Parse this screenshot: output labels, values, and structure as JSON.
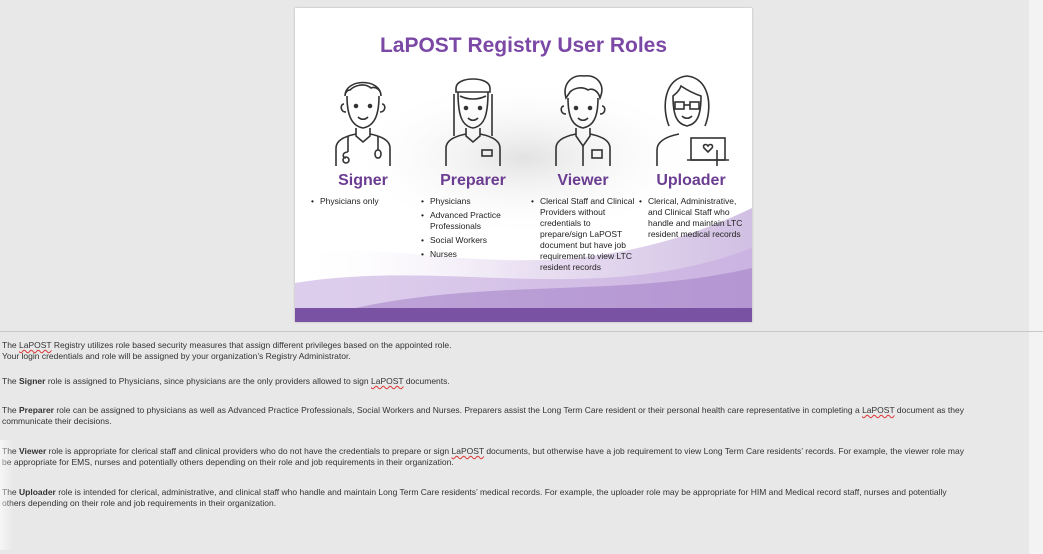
{
  "slide": {
    "title": "LaPOST Registry User Roles",
    "accent_color": "#7b48a6",
    "roles": [
      {
        "name": "Signer",
        "icon": "doctor-icon",
        "bullets": [
          "Physicians only"
        ]
      },
      {
        "name": "Preparer",
        "icon": "nurse-icon",
        "bullets": [
          "Physicians",
          "Advanced Practice Professionals",
          "Social Workers",
          "Nurses"
        ]
      },
      {
        "name": "Viewer",
        "icon": "staff-icon",
        "bullets": [
          "Clerical Staff and Clinical Providers without credentials to prepare/sign LaPOST document but have job requirement to view LTC resident records"
        ]
      },
      {
        "name": "Uploader",
        "icon": "laptop-user-icon",
        "bullets": [
          "Clerical, Administrative, and Clinical Staff who handle and maintain LTC resident medical records"
        ]
      }
    ]
  },
  "body_text": {
    "intro_1a": "The ",
    "intro_1b": "LaPOST",
    "intro_1c": " Registry utilizes role based security measures that assign different privileges based on the appointed role.",
    "intro_2": "Your login credentials and role will be assigned by your organization’s Registry Administrator.",
    "signer_label": "Signer",
    "signer_text": " role is assigned to Physicians, since physicians are the only providers allowed to sign ",
    "signer_tail": " documents.",
    "preparer_label": "Preparer",
    "preparer_text": " role can be assigned to physicians as well as Advanced Practice Professionals, Social Workers and Nurses. Preparers assist the Long Term Care resident or their personal health care representative in completing a ",
    "preparer_line2": "communicate their decisions.",
    "preparer_tail": " document as they",
    "viewer_label": "Viewer",
    "viewer_text": " role is appropriate for clerical staff and clinical providers who do not have the credentials to prepare or sign ",
    "viewer_tail": " documents, but otherwise have a job requirement to view Long Term Care residents’ records. For example, the viewer role may",
    "viewer_line2": "be appropriate for EMS, nurses and potentially others depending on their role and job requirements in their organization.",
    "uploader_label": "Uploader",
    "uploader_text": " role is intended for clerical, administrative, and clinical staff who handle and maintain Long Term Care residents’ medical records. For example, the uploader role may be appropriate for HIM and Medical record staff, nurses and potentially",
    "uploader_line2": "others depending on their role and  job requirements in their organization.",
    "the": "The ",
    "lapost": "LaPOST"
  }
}
